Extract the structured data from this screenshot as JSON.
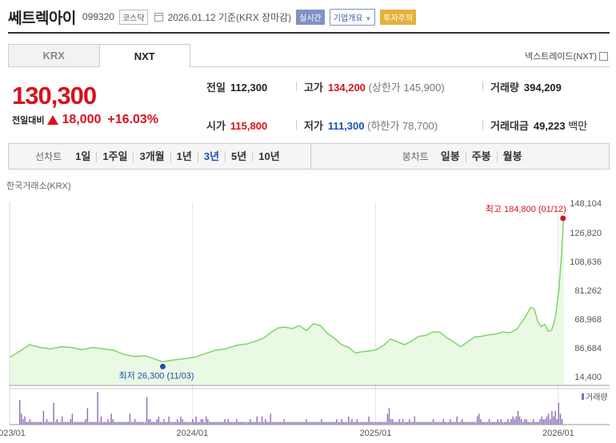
{
  "header": {
    "stock_name": "쎄트렉아이",
    "stock_code": "099320",
    "market": "코스닥",
    "date_text": "2026.01.12 기준(KRX 장마감)",
    "badges": {
      "live": "실시간",
      "company": "기업개요",
      "warning": "투자주의"
    }
  },
  "tabs": [
    {
      "label": "KRX",
      "selected": false
    },
    {
      "label": "NXT",
      "selected": true
    }
  ],
  "nxt_link": "넥스트레이드(NXT)",
  "price": {
    "current": "130,300",
    "change_label": "전일대비",
    "change_amount": "18,000",
    "change_percent": "+16.03%",
    "direction": "up"
  },
  "stats": {
    "prev_label": "전일",
    "prev_value": "112,300",
    "high_label": "고가",
    "high_value": "134,200",
    "upper_limit": "(상한가 145,900)",
    "volume_label": "거래량",
    "volume_value": "394,209",
    "open_label": "시가",
    "open_value": "115,800",
    "low_label": "저가",
    "low_value": "111,300",
    "lower_limit": "(하한가 78,700)",
    "amount_label": "거래대금",
    "amount_value": "49,223",
    "amount_unit": "백만"
  },
  "period_bar": {
    "line_label": "선차트",
    "line_periods": [
      "1일",
      "1주일",
      "3개월",
      "1년",
      "3년",
      "5년",
      "10년"
    ],
    "selected_period": "3년",
    "candle_label": "봉차트",
    "candle_periods": [
      "일봉",
      "주봉",
      "월봉"
    ]
  },
  "exchange_label": "한국거래소(KRX)",
  "colors": {
    "up": "#d5121e",
    "down": "#1d4fb0",
    "line": "#7fd46a",
    "fill": "#e9f9e3",
    "volume": "#8b6bb5",
    "accent": "#8091c4"
  },
  "chart_data": {
    "type": "area",
    "y_tick_labels": [
      "148,104",
      "126,820",
      "108,636",
      "81,262",
      "68,968",
      "86,684",
      "14,400"
    ],
    "x_tick_labels": [
      "2023/01",
      "2024/01",
      "2025/01",
      "2026/01"
    ],
    "high_annotation": "최고 184,800 (01/12)",
    "low_annotation": "최저 26,300 (11/03)",
    "volume_label": "거래량",
    "price_series": [
      [
        "2023/01/02",
        29500
      ],
      [
        "2023/01/20",
        33500
      ],
      [
        "2023/02/10",
        38500
      ],
      [
        "2023/03/03",
        36500
      ],
      [
        "2023/03/24",
        35500
      ],
      [
        "2023/04/14",
        37000
      ],
      [
        "2023/05/05",
        36500
      ],
      [
        "2023/05/26",
        35000
      ],
      [
        "2023/06/16",
        36500
      ],
      [
        "2023/07/07",
        35500
      ],
      [
        "2023/07/28",
        34500
      ],
      [
        "2023/08/18",
        31500
      ],
      [
        "2023/09/08",
        30000
      ],
      [
        "2023/09/29",
        30500
      ],
      [
        "2023/10/20",
        28000
      ],
      [
        "2023/11/03",
        26300
      ],
      [
        "2023/11/24",
        27500
      ],
      [
        "2023/12/15",
        28500
      ],
      [
        "2024/01/05",
        29500
      ],
      [
        "2024/01/26",
        32000
      ],
      [
        "2024/02/16",
        34500
      ],
      [
        "2024/03/08",
        35500
      ],
      [
        "2024/03/29",
        38000
      ],
      [
        "2024/04/19",
        39000
      ],
      [
        "2024/05/10",
        41500
      ],
      [
        "2024/05/24",
        43500
      ],
      [
        "2024/06/07",
        47500
      ],
      [
        "2024/06/21",
        50500
      ],
      [
        "2024/07/05",
        51000
      ],
      [
        "2024/07/19",
        50000
      ],
      [
        "2024/08/02",
        52000
      ],
      [
        "2024/08/16",
        48500
      ],
      [
        "2024/08/30",
        53500
      ],
      [
        "2024/09/13",
        52000
      ],
      [
        "2024/09/27",
        46500
      ],
      [
        "2024/10/11",
        43000
      ],
      [
        "2024/10/25",
        38500
      ],
      [
        "2024/11/08",
        36500
      ],
      [
        "2024/11/22",
        32500
      ],
      [
        "2024/12/06",
        33500
      ],
      [
        "2024/12/20",
        34000
      ],
      [
        "2025/01/03",
        35000
      ],
      [
        "2025/01/17",
        38000
      ],
      [
        "2025/01/31",
        42500
      ],
      [
        "2025/02/14",
        40500
      ],
      [
        "2025/02/28",
        38500
      ],
      [
        "2025/03/14",
        41000
      ],
      [
        "2025/03/28",
        44500
      ],
      [
        "2025/04/11",
        45000
      ],
      [
        "2025/04/25",
        47500
      ],
      [
        "2025/05/09",
        47500
      ],
      [
        "2025/05/23",
        43500
      ],
      [
        "2025/06/06",
        40500
      ],
      [
        "2025/06/20",
        37000
      ],
      [
        "2025/07/04",
        40500
      ],
      [
        "2025/07/18",
        44000
      ],
      [
        "2025/08/01",
        44500
      ],
      [
        "2025/08/15",
        45500
      ],
      [
        "2025/08/29",
        46000
      ],
      [
        "2025/09/12",
        47500
      ],
      [
        "2025/09/26",
        47000
      ],
      [
        "2025/10/10",
        49500
      ],
      [
        "2025/10/24",
        56500
      ],
      [
        "2025/11/07",
        65000
      ],
      [
        "2025/11/14",
        64000
      ],
      [
        "2025/11/21",
        55000
      ],
      [
        "2025/11/28",
        51500
      ],
      [
        "2025/12/05",
        53000
      ],
      [
        "2025/12/12",
        48000
      ],
      [
        "2025/12/19",
        49000
      ],
      [
        "2025/12/26",
        57500
      ],
      [
        "2026/01/02",
        77000
      ],
      [
        "2026/01/07",
        100000
      ],
      [
        "2026/01/12",
        130300
      ]
    ],
    "volume_series": [
      9,
      4,
      2,
      3,
      1,
      1,
      2,
      1,
      1,
      1,
      1,
      1,
      1,
      1,
      5,
      1,
      2,
      1,
      1,
      1,
      8,
      1,
      2,
      1,
      1,
      3,
      1,
      1,
      1,
      1,
      2,
      4,
      1,
      1,
      1,
      1,
      1,
      1,
      1,
      2,
      6,
      1,
      1,
      1,
      1,
      1,
      12,
      1,
      3,
      1,
      1,
      1,
      2,
      1,
      4,
      2,
      1,
      1,
      1,
      1,
      1,
      1,
      1,
      1,
      1,
      4,
      1,
      1,
      2,
      1,
      1,
      1,
      1,
      1,
      1,
      10,
      2,
      2,
      1,
      1,
      1,
      2,
      3,
      1,
      1,
      2,
      1,
      1,
      3,
      1,
      1,
      1,
      1,
      2,
      1,
      3,
      2,
      1,
      1,
      1,
      1,
      1,
      2,
      1,
      3,
      1,
      1,
      2,
      2,
      1,
      3,
      2,
      1,
      1,
      1,
      1,
      1,
      1,
      1,
      1,
      1,
      2,
      1,
      2,
      1,
      1,
      1,
      1,
      2,
      1,
      1,
      1,
      1,
      1,
      1,
      1,
      2,
      1,
      1,
      1,
      3,
      1,
      1,
      3,
      1,
      2,
      1,
      1,
      4,
      1,
      1,
      1,
      1,
      1,
      1,
      1,
      2,
      1,
      1,
      1,
      1,
      1,
      1,
      1,
      1,
      1,
      1,
      1,
      1,
      2,
      1,
      1,
      1,
      1,
      1,
      1,
      1,
      1,
      2,
      1,
      1,
      1,
      1,
      1,
      1,
      1,
      1,
      2,
      1,
      1,
      2,
      1,
      1,
      1,
      3,
      1,
      2,
      1,
      1,
      2,
      1,
      1,
      1,
      1,
      1,
      1,
      3,
      1,
      1,
      1,
      1,
      1,
      1,
      1,
      1,
      1,
      1,
      4,
      6,
      2,
      2,
      1,
      1,
      1,
      2,
      1,
      2,
      1,
      1,
      1,
      2,
      1,
      1,
      3,
      1,
      1,
      1,
      1,
      1,
      1,
      1,
      1,
      1,
      1,
      2,
      1,
      1,
      1,
      1,
      1,
      2,
      1,
      1,
      1,
      2,
      1,
      1,
      1,
      3,
      1,
      1,
      2,
      1,
      1,
      1,
      1,
      1,
      1,
      1,
      1,
      3,
      4,
      2,
      1,
      1,
      1,
      1,
      2,
      1,
      1,
      1,
      1,
      2,
      1,
      2,
      1,
      1,
      1,
      2,
      1,
      2,
      3,
      2,
      3,
      5,
      3,
      2,
      1,
      2,
      2,
      1,
      1,
      1,
      2,
      1,
      1,
      1,
      2,
      3,
      2,
      2,
      3,
      4,
      2,
      5,
      3,
      5,
      2,
      8,
      4,
      2
    ]
  }
}
